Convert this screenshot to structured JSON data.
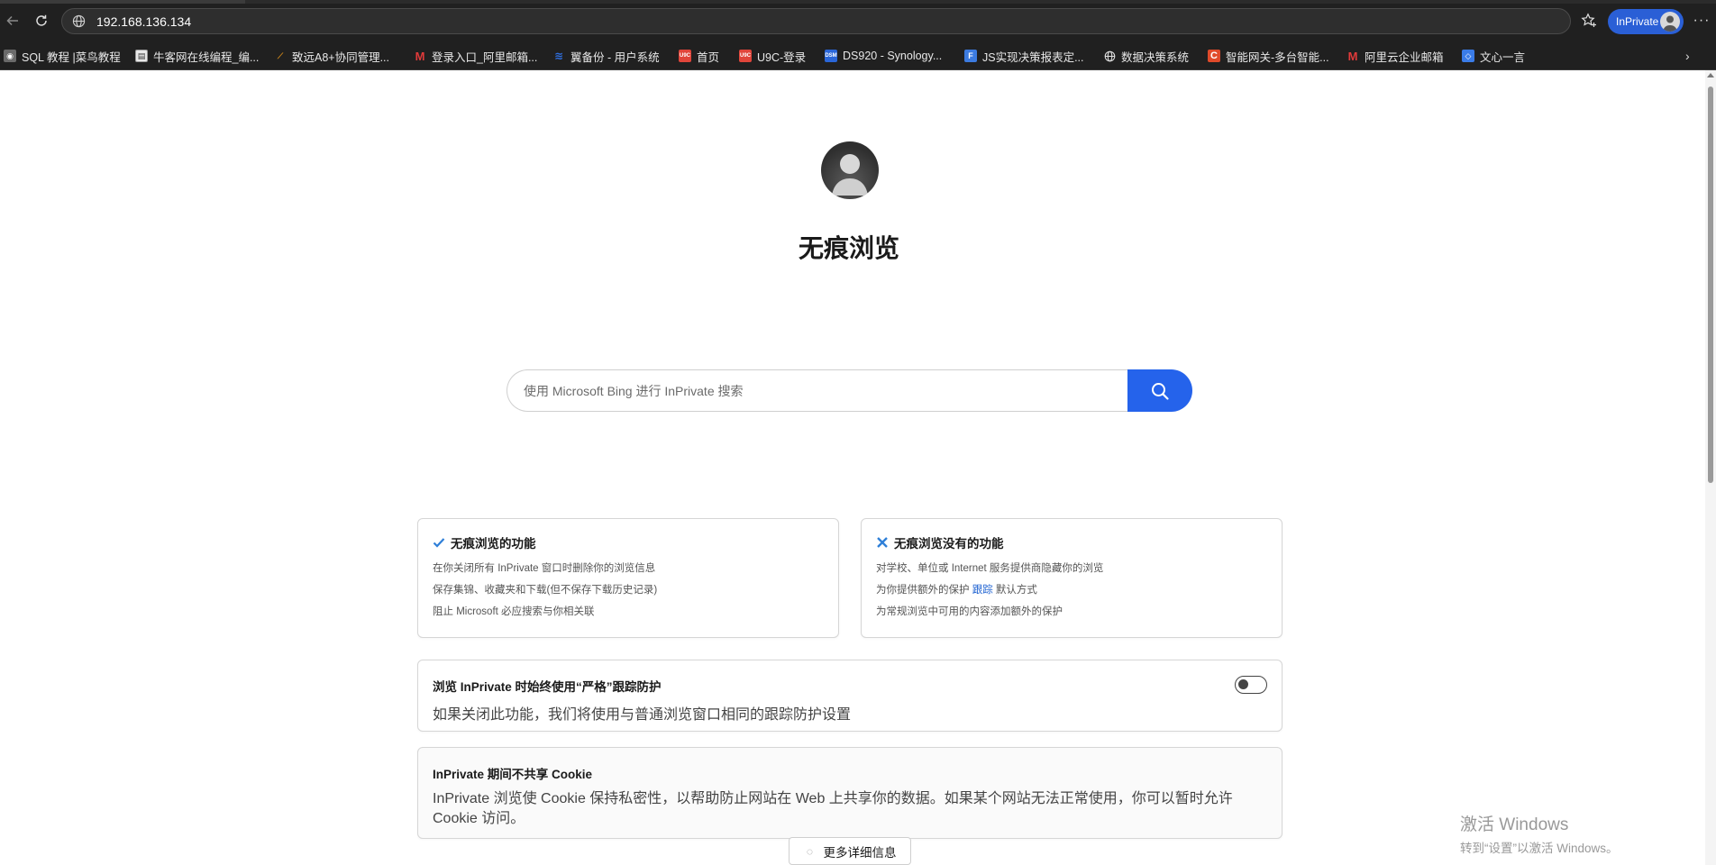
{
  "browser": {
    "url": "192.168.136.134",
    "inprivate_label": "InPrivate"
  },
  "bookmarks": [
    {
      "label": "SQL 教程 |菜鸟教程",
      "icon": "runoob-icon",
      "color": "#6a6a6a"
    },
    {
      "label": "牛客网在线编程_编...",
      "icon": "nowcoder-icon",
      "color": "#e8e8e8"
    },
    {
      "label": "致远A8+协同管理...",
      "icon": "seeyon-icon",
      "color": "#d48a1a"
    },
    {
      "label": "登录入口_阿里邮箱...",
      "icon": "aliyun-mail-icon",
      "color": "#e03a3a"
    },
    {
      "label": "翼备份 - 用户系统",
      "icon": "backup-icon",
      "color": "#2f6fe0"
    },
    {
      "label": "首页",
      "icon": "u9c-icon",
      "color": "#e0453a"
    },
    {
      "label": "U9C-登录",
      "icon": "u9c-icon",
      "color": "#e0453a"
    },
    {
      "label": "DS920 - Synology...",
      "icon": "dsm-icon",
      "color": "#2a66d8"
    },
    {
      "label": "JS实现决策报表定...",
      "icon": "finereport-icon",
      "color": "#3c7be0"
    },
    {
      "label": "数据决策系统",
      "icon": "globe-icon",
      "color": "#e8e8e8"
    },
    {
      "label": "智能网关-多台智能...",
      "icon": "c-brand-icon",
      "color": "#e04a2a"
    },
    {
      "label": "阿里云企业邮箱",
      "icon": "aliyun-mail-icon",
      "color": "#e03a3a"
    },
    {
      "label": "文心一言",
      "icon": "wenxin-icon",
      "color": "#3a7ce8"
    }
  ],
  "main": {
    "title": "无痕浏览",
    "search_placeholder": "使用 Microsoft Bing 进行 InPrivate 搜索",
    "can_card": {
      "title": "无痕浏览的功能",
      "lines": [
        "在你关闭所有 InPrivate 窗口时删除你的浏览信息",
        "保存集锦、收藏夹和下载(但不保存下载历史记录)",
        "阻止 Microsoft 必应搜索与你相关联"
      ]
    },
    "cannot_card": {
      "title": "无痕浏览没有的功能",
      "line1": "对学校、单位或 Internet 服务提供商隐藏你的浏览",
      "line2_prefix": "为你提供额外的保护",
      "line2_link": "跟踪",
      "line2_suffix": "默认方式",
      "line3": "为常规浏览中可用的内容添加额外的保护"
    },
    "strict_tracking": {
      "title": "浏览 InPrivate 时始终使用“严格”跟踪防护",
      "desc": "如果关闭此功能，我们将使用与普通浏览窗口相同的跟踪防护设置",
      "toggle_on": false
    },
    "cookie": {
      "title": "InPrivate 期间不共享 Cookie",
      "desc": "InPrivate 浏览使 Cookie 保持私密性，以帮助防止网站在 Web 上共享你的数据。如果某个网站无法正常使用，你可以暂时允许 Cookie 访问。"
    },
    "more_info_label": "更多详细信息"
  },
  "watermark": {
    "line1": "激活 Windows",
    "line2": "转到“设置”以激活 Windows。"
  },
  "colors": {
    "accent": "#2563eb",
    "chrome_bg": "#202020",
    "inprivate_pill": "#2a5fd6",
    "link": "#1a5fd0"
  }
}
